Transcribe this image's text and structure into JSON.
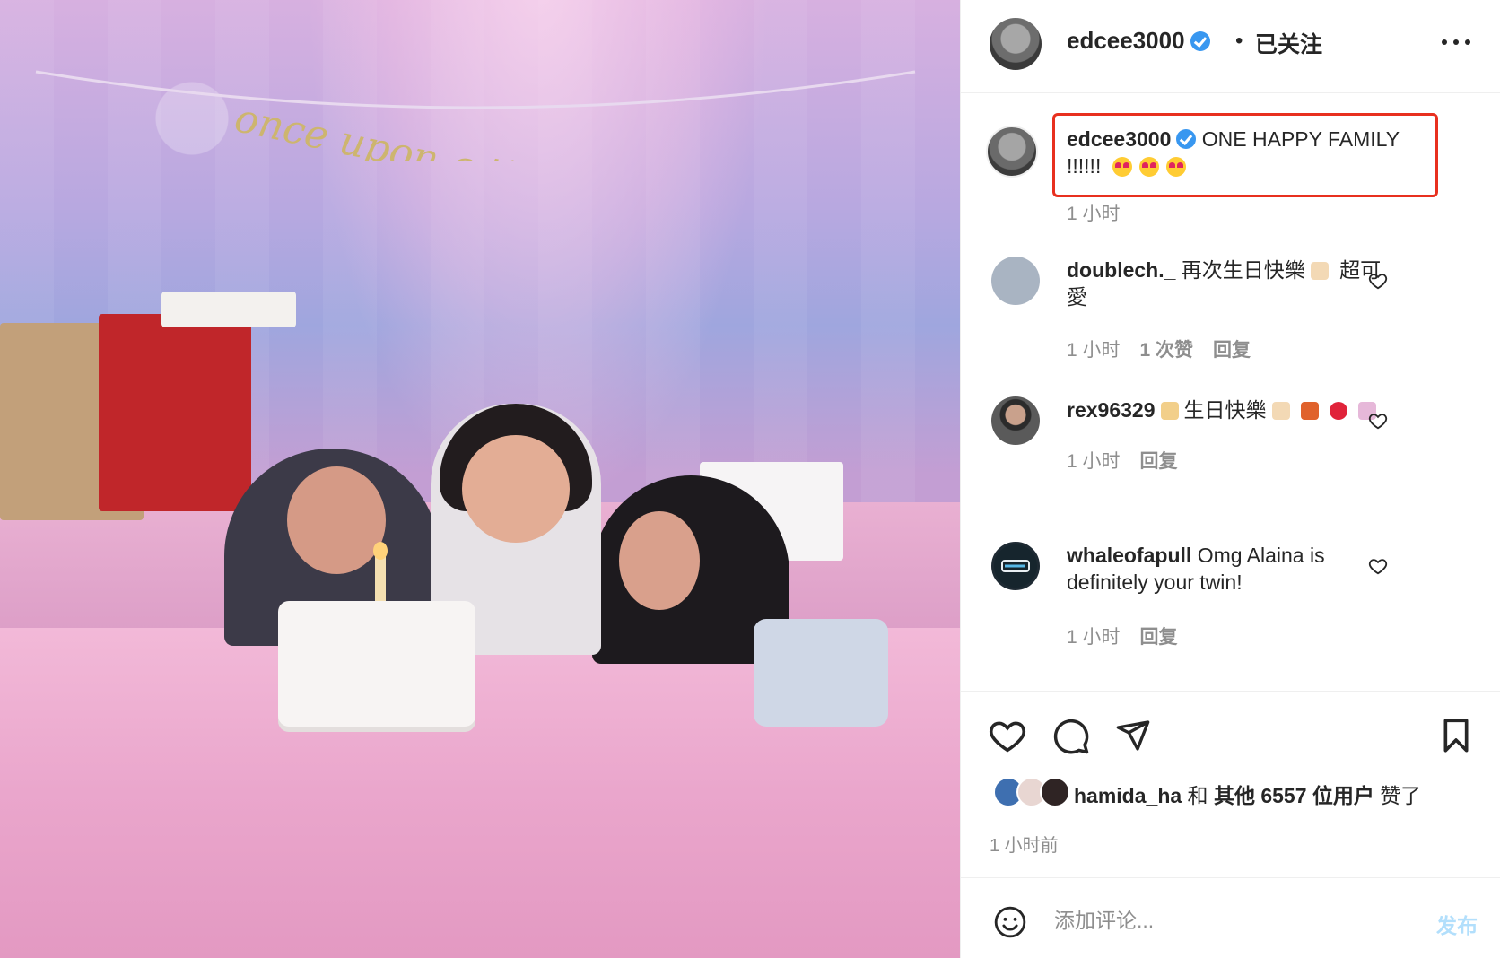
{
  "photo": {
    "alt_icon": "photo-image",
    "banner_text": "once upon a time"
  },
  "header": {
    "username": "edcee3000",
    "dot": "•",
    "follow_status": "已关注"
  },
  "caption": {
    "username": "edcee3000",
    "text": "ONE HAPPY FAMILY",
    "text2": "!!!!!!",
    "time": "1 小时"
  },
  "comments": [
    {
      "username": "doublech._",
      "text": "再次生日快樂",
      "text_after": " 超可",
      "text_line2": "愛",
      "time": "1 小时",
      "likes": "1 次赞",
      "reply": "回复"
    },
    {
      "username": "rex96329",
      "text": "生日快樂",
      "time": "1 小时",
      "reply": "回复"
    },
    {
      "username": "whaleofapull",
      "text": "Omg Alaina is",
      "text_line2": "definitely your twin!",
      "time": "1 小时",
      "reply": "回复"
    }
  ],
  "likes": {
    "first_user": "hamida_ha",
    "connector": " 和 ",
    "others": "其他 6557 位用户",
    "suffix": " 赞了"
  },
  "post_time": "1 小时前",
  "composer": {
    "placeholder": "添加评论...",
    "post_label": "发布"
  },
  "colors": {
    "verified": "#3897f0",
    "highlight_box": "#e8301f",
    "post_disabled": "#b2dffc",
    "muted_text": "#8e8e8e"
  }
}
